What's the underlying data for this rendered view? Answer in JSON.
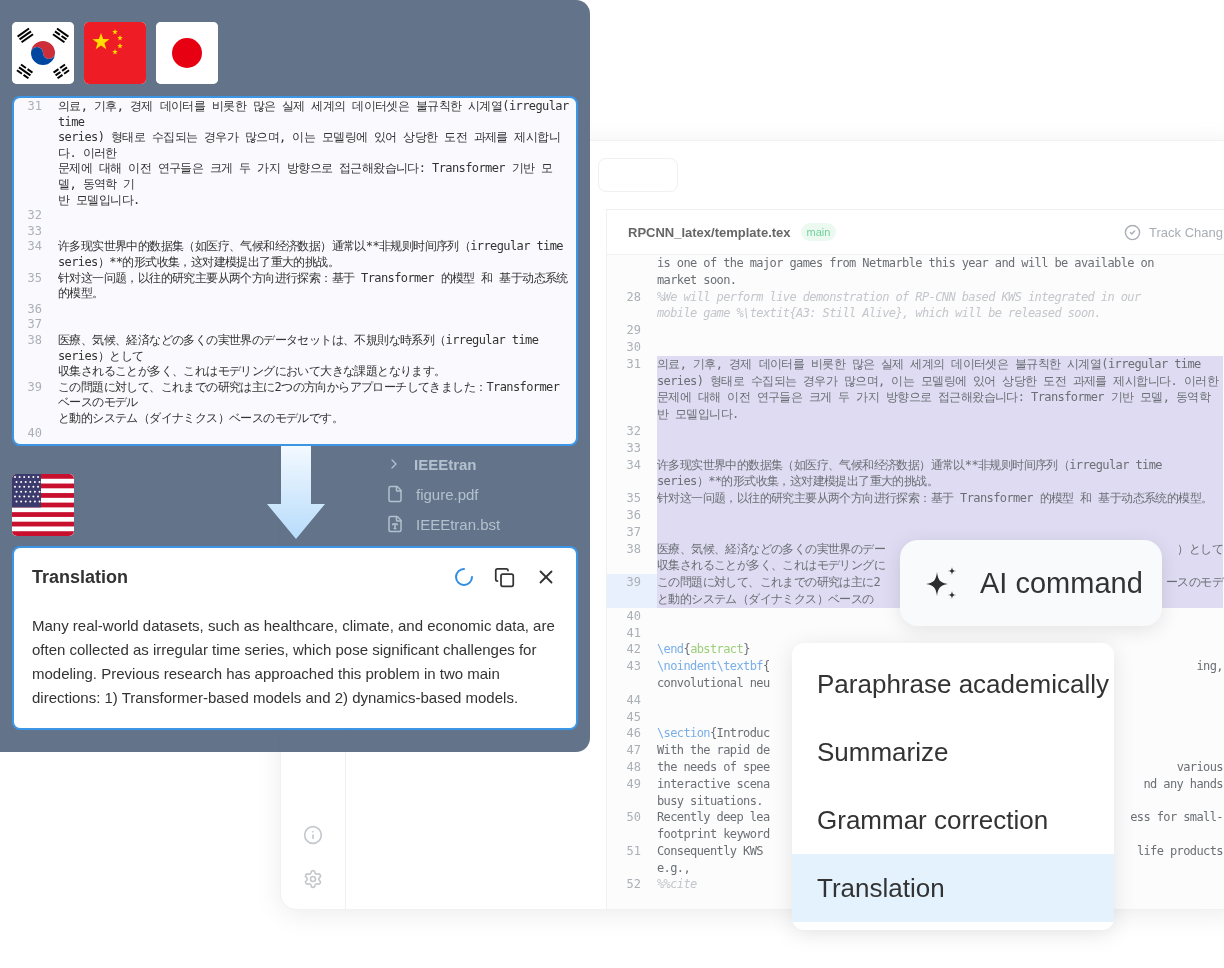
{
  "overlay": {
    "source_flags": [
      {
        "kind": "korea"
      },
      {
        "kind": "china"
      },
      {
        "kind": "japan"
      }
    ],
    "source_lines": [
      {
        "number": "31",
        "rows": [
          {
            "text": "의료, 기후, 경제 데이터를 비롯한 많은 실제 세계의 데이터셋은 불규칙한 시계열(irregular time"
          },
          {
            "text": "series) 형태로 수집되는 경우가 많으며, 이는 모델링에 있어 상당한 도전 과제를 제시합니다. 이러한"
          },
          {
            "text": "문제에 대해 이전 연구들은 크게 두 가지 방향으로 접근해왔습니다: Transformer 기반 모델, 동역학 기"
          },
          {
            "text": "반 모델입니다."
          }
        ]
      },
      {
        "number": "32"
      },
      {
        "number": "33"
      },
      {
        "number": "34",
        "rows": [
          {
            "text": "许多现实世界中的数据集（如医疗、气候和经济数据）通常以**非规则时间序列（irregular time"
          },
          {
            "text": "series）**的形式收集，这对建模提出了重大的挑战。"
          }
        ]
      },
      {
        "number": "35",
        "rows": [
          {
            "text": "针对这一问题，以往的研究主要从两个方向进行探索：基于 Transformer 的模型 和 基于动态系统的模型。"
          }
        ]
      },
      {
        "number": "36"
      },
      {
        "number": "37"
      },
      {
        "number": "38",
        "rows": [
          {
            "text": "医療、気候、経済などの多くの実世界のデータセットは、不規則な時系列（irregular time series）として"
          },
          {
            "text": "収集されることが多く、これはモデリングにおいて大きな課題となります。"
          }
        ]
      },
      {
        "number": "39",
        "rows": [
          {
            "text": "この問題に対して、これまでの研究は主に2つの方向からアプローチしてきました：Transformer ベースのモデル"
          },
          {
            "text": "と動的システム（ダイナミクス）ベースのモデルです。"
          }
        ]
      },
      {
        "number": "40"
      }
    ],
    "target_flag": {
      "kind": "usa"
    },
    "translation": {
      "title": "Translation",
      "text": "Many real-world datasets, such as healthcare, climate, and economic data, are often collected as irregular time series, which pose significant challenges for modeling. Previous research has approached this problem in two main directions: 1) Transformer-based models and 2) dynamics-based models."
    }
  },
  "app": {
    "file_tree": [
      {
        "kind": "folder",
        "name": "IEEEtran"
      },
      {
        "kind": "pdf",
        "name": "figure.pdf"
      },
      {
        "kind": "text",
        "name": "IEEEtran.bst"
      }
    ],
    "editor": {
      "file_path": "RPCNN_latex/template.tex",
      "branch": "main",
      "track_changes": "Track Chang",
      "lines": [
        {
          "highlighted": false,
          "current": false,
          "rows": [
            {
              "text": "is one of the major games from Netmarble this year and will be available on"
            },
            {
              "text": "market soon."
            }
          ]
        },
        {
          "number": "28",
          "highlighted": false,
          "current": false,
          "rows": [
            {
              "kind": "comment",
              "text": "%We will perform live demonstration of RP-CNN based KWS integrated in our"
            },
            {
              "kind": "comment",
              "text": "mobile game %\\textit{A3: Still Alive}, which will be released soon."
            }
          ]
        },
        {
          "number": "29",
          "highlighted": false,
          "current": false
        },
        {
          "number": "30",
          "highlighted": false,
          "current": false
        },
        {
          "number": "31",
          "highlighted": true,
          "current": false,
          "rows": [
            {
              "text": "의료, 기후, 경제 데이터를 비롯한 많은 실제 세계의 데이터셋은 불규칙한 시계열(irregular time"
            },
            {
              "text": "series) 형태로 수집되는 경우가 많으며, 이는 모델링에 있어 상당한 도전 과제를 제시합니다. 이러한"
            },
            {
              "text": "문제에 대해 이전 연구들은 크게 두 가지 방향으로 접근해왔습니다: Transformer 기반 모델, 동역학"
            },
            {
              "text": "반 모델입니다."
            }
          ]
        },
        {
          "number": "32",
          "highlighted": true,
          "current": false
        },
        {
          "number": "33",
          "highlighted": true,
          "current": false
        },
        {
          "number": "34",
          "highlighted": true,
          "current": false,
          "rows": [
            {
              "text": "许多现实世界中的数据集（如医疗、气候和经济数据）通常以**非规则时间序列（irregular time"
            },
            {
              "text": "series）**的形式收集，这对建模提出了重大的挑战。"
            }
          ]
        },
        {
          "number": "35",
          "highlighted": true,
          "current": false,
          "rows": [
            {
              "text": "针对这一问题，以往的研究主要从两个方向进行探索：基于 Transformer 的模型 和 基于动态系统的模型。"
            }
          ]
        },
        {
          "number": "36",
          "highlighted": true,
          "current": false
        },
        {
          "number": "37",
          "highlighted": true,
          "current": false
        },
        {
          "number": "38",
          "highlighted": true,
          "current": false,
          "rows": [
            {
              "text": "医療、気候、経済などの多くの実世界のデー",
              "tail": "）として"
            },
            {
              "text": "収集されることが多く、これはモデリングに"
            }
          ]
        },
        {
          "number": "39",
          "highlighted": true,
          "current": true,
          "rows": [
            {
              "text": "この問題に対して、これまでの研究は主に2",
              "tail": "ースのモデ"
            },
            {
              "text": "と動的システム（ダイナミクス）ベースの"
            }
          ]
        },
        {
          "number": "40",
          "highlighted": false,
          "current": false
        },
        {
          "number": "41",
          "highlighted": false,
          "current": false
        },
        {
          "number": "42",
          "highlighted": false,
          "current": false,
          "rows": [
            {
              "segments": [
                {
                  "kind": "command",
                  "text": "\\end"
                },
                {
                  "kind": "plain",
                  "text": "{"
                },
                {
                  "kind": "argument",
                  "text": "abstract"
                },
                {
                  "kind": "plain",
                  "text": "}"
                }
              ]
            }
          ]
        },
        {
          "number": "43",
          "highlighted": false,
          "current": false,
          "rows": [
            {
              "segments": [
                {
                  "kind": "command",
                  "text": "\\noindent\\textbf"
                },
                {
                  "kind": "plain",
                  "text": "{"
                }
              ],
              "tail": "ing,"
            },
            {
              "text": "convolutional neu"
            }
          ]
        },
        {
          "number": "44",
          "highlighted": false,
          "current": false
        },
        {
          "number": "45",
          "highlighted": false,
          "current": false
        },
        {
          "number": "46",
          "highlighted": false,
          "current": false,
          "rows": [
            {
              "segments": [
                {
                  "kind": "command",
                  "text": "\\section"
                },
                {
                  "kind": "plain",
                  "text": "{Introduc"
                }
              ]
            }
          ]
        },
        {
          "number": "47",
          "highlighted": false,
          "current": false,
          "rows": [
            {
              "text": "With the rapid de"
            }
          ]
        },
        {
          "number": "48",
          "highlighted": false,
          "current": false,
          "rows": [
            {
              "text": "the needs of spee",
              "tail": "various"
            }
          ]
        },
        {
          "number": "49",
          "highlighted": false,
          "current": false,
          "rows": [
            {
              "text": "interactive scena",
              "tail": "nd any hands"
            },
            {
              "text": "busy situations."
            }
          ]
        },
        {
          "number": "50",
          "highlighted": false,
          "current": false,
          "rows": [
            {
              "text": "Recently deep lea",
              "tail": "ess for small-"
            },
            {
              "text": "footprint keyword"
            }
          ]
        },
        {
          "number": "51",
          "highlighted": false,
          "current": false,
          "rows": [
            {
              "text": "Consequently KWS",
              "tail": "life products"
            },
            {
              "text": "e.g.,"
            }
          ]
        },
        {
          "number": "52",
          "highlighted": false,
          "current": false,
          "rows": [
            {
              "kind": "comment",
              "text": "%%cite"
            }
          ]
        }
      ]
    }
  },
  "ai_command": {
    "label": "AI command"
  },
  "menu": [
    {
      "label": "Paraphrase academically",
      "selected": false
    },
    {
      "label": "Summarize",
      "selected": false
    },
    {
      "label": "Grammar correction",
      "selected": false
    },
    {
      "label": "Translation",
      "selected": true
    }
  ]
}
